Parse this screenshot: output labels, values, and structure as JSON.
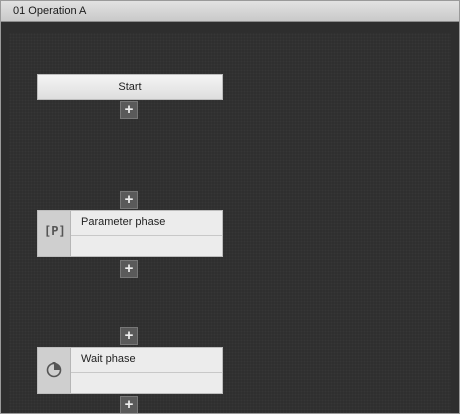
{
  "window": {
    "title": "01 Operation A"
  },
  "start": {
    "label": "Start"
  },
  "add_step": {
    "symbol": "+"
  },
  "phases": [
    {
      "label": "Parameter phase",
      "icon": "parameter-icon",
      "icon_text": "[P]"
    },
    {
      "label": "Wait phase",
      "icon": "clock-icon"
    }
  ]
}
